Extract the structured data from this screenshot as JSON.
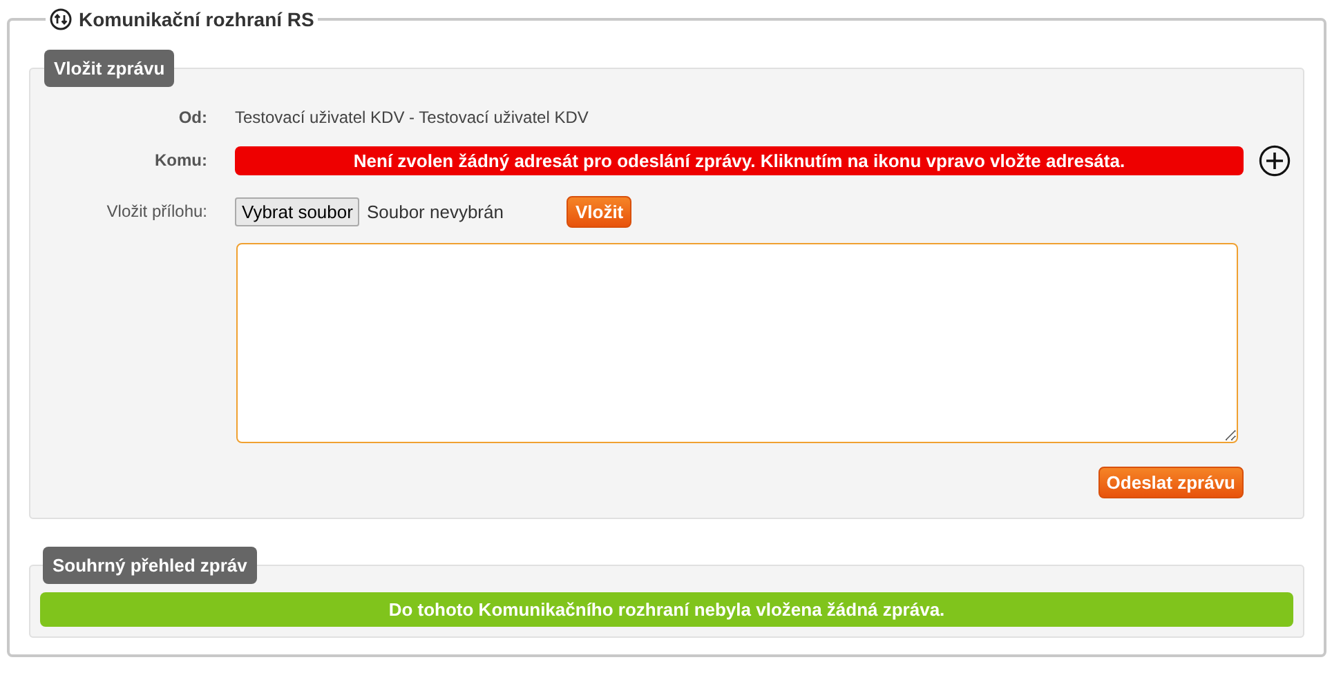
{
  "title": "Komunikační rozhraní RS",
  "compose": {
    "title": "Vložit zprávu",
    "from": {
      "label": "Od:",
      "value": "Testovací uživatel KDV - Testovací uživatel KDV"
    },
    "to": {
      "label": "Komu:",
      "error": "Není zvolen žádný adresát pro odeslání zprávy. Kliknutím na ikonu vpravo vložte adresáta."
    },
    "attachment": {
      "label": "Vložit přílohu:",
      "file_button": "Vybrat soubor",
      "file_status": "Soubor nevybrán",
      "insert_button": "Vložit"
    },
    "send_button": "Odeslat zprávu"
  },
  "summary": {
    "title": "Souhrný přehled zpráv",
    "message": "Do tohoto Komunikačního rozhraní nebyla vložena žádná zpráva."
  }
}
